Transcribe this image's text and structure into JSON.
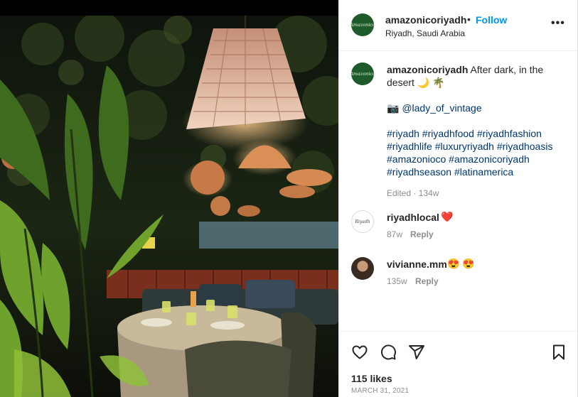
{
  "post": {
    "username": "amazonicoriyadh",
    "follow_label": "Follow",
    "separator": "•",
    "location": "Riyadh, Saudi Arabia",
    "more_label": "•••",
    "logo_text": "Amazonico"
  },
  "caption": {
    "username": "amazonicoriyadh",
    "text": "After dark, in the desert",
    "emoji": "🌙 🌴",
    "credit_emoji": "📷",
    "credit_handle": "@lady_of_vintage",
    "hashtag_lines": [
      "#riyadh #riyadhfood #riyadhfashion",
      "#riyadhlife #luxuryriyadh #riyadhoasis",
      "#amazonioco #amazonicoriyadh",
      "#riyadhseason #latinamerica"
    ],
    "edited_label": "Edited",
    "meta_separator": "·",
    "time": "134w"
  },
  "comments": [
    {
      "username": "riyadhlocal",
      "emoji": "❤️",
      "time": "87w",
      "reply_label": "Reply",
      "avatar_text": "Riyadh"
    },
    {
      "username": "vivianne.mm",
      "emoji": "😍 😍",
      "time": "135w",
      "reply_label": "Reply"
    }
  ],
  "footer": {
    "likes": "115 likes",
    "date": "MARCH 31, 2021"
  },
  "icons": [
    "heart-icon",
    "comment-icon",
    "share-icon",
    "bookmark-icon",
    "more-icon"
  ],
  "colors": {
    "link_blue": "#0095f6",
    "hashtag": "#00376b",
    "muted": "#8e8e8e",
    "logo_green": "#1f5a2a"
  }
}
